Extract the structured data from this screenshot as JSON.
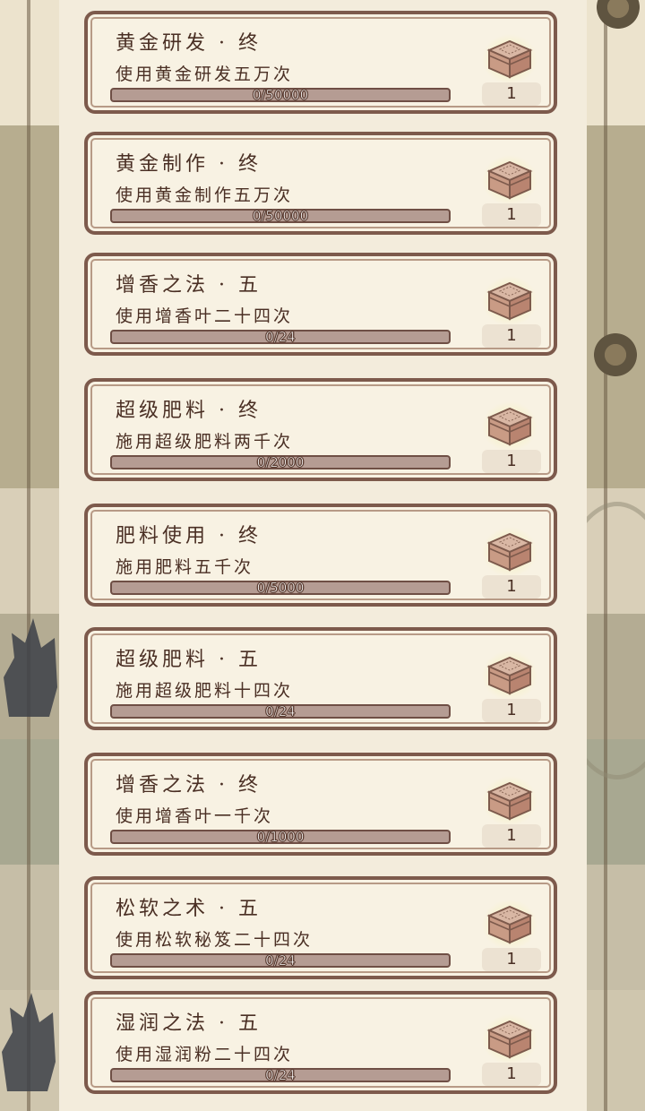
{
  "colors": {
    "card_border": "#7d5a4c",
    "card_background": "#f8f2e3",
    "progress_track": "#b59c93",
    "text": "#4a2f24"
  },
  "quests": [
    {
      "title": "黄金研发 · 终",
      "description": "使用黄金研发五万次",
      "progress_text": "0/50000",
      "progress": 0,
      "reward_icon": "treasure-box-icon",
      "reward_count": "1"
    },
    {
      "title": "黄金制作 · 终",
      "description": "使用黄金制作五万次",
      "progress_text": "0/50000",
      "progress": 0,
      "reward_icon": "treasure-box-icon",
      "reward_count": "1"
    },
    {
      "title": "增香之法 · 五",
      "description": "使用增香叶二十四次",
      "progress_text": "0/24",
      "progress": 0,
      "reward_icon": "treasure-box-icon",
      "reward_count": "1"
    },
    {
      "title": "超级肥料 · 终",
      "description": "施用超级肥料两千次",
      "progress_text": "0/2000",
      "progress": 0,
      "reward_icon": "treasure-box-icon",
      "reward_count": "1"
    },
    {
      "title": "肥料使用 · 终",
      "description": "施用肥料五千次",
      "progress_text": "0/5000",
      "progress": 0,
      "reward_icon": "treasure-box-icon",
      "reward_count": "1"
    },
    {
      "title": "超级肥料 · 五",
      "description": "施用超级肥料十四次",
      "progress_text": "0/24",
      "progress": 0,
      "reward_icon": "treasure-box-icon",
      "reward_count": "1"
    },
    {
      "title": "增香之法 · 终",
      "description": "使用增香叶一千次",
      "progress_text": "0/1000",
      "progress": 0,
      "reward_icon": "treasure-box-icon",
      "reward_count": "1"
    },
    {
      "title": "松软之术 · 五",
      "description": "使用松软秘笈二十四次",
      "progress_text": "0/24",
      "progress": 0,
      "reward_icon": "treasure-box-icon",
      "reward_count": "1"
    },
    {
      "title": "湿润之法 · 五",
      "description": "使用湿润粉二十四次",
      "progress_text": "0/24",
      "progress": 0,
      "reward_icon": "treasure-box-icon",
      "reward_count": "1"
    }
  ]
}
